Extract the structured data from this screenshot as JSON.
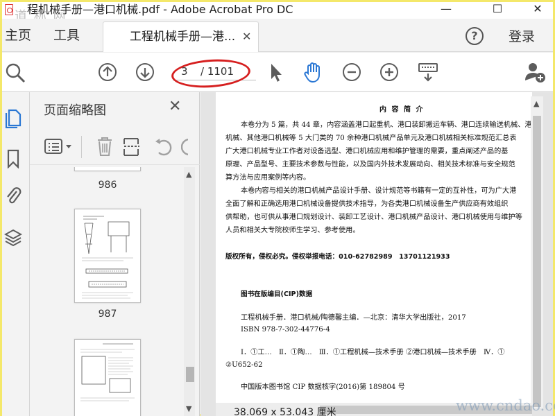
{
  "window": {
    "title": "程机械手册—港口机械.pdf - Adobe Acrobat Pro DC",
    "watermark_top": "道 称 网",
    "minimize": "—",
    "maximize": "☐",
    "close": "✕"
  },
  "tabs": {
    "home": "主页",
    "tools": "工具",
    "document": "工程机械手册—港...",
    "close": "✕",
    "login": "登录",
    "help": "?"
  },
  "toolbar": {
    "current_page": "3",
    "total_pages": "/ 1101"
  },
  "thumbnail_panel": {
    "title": "页面缩略图",
    "close": "✕",
    "pages": [
      "986",
      "987"
    ]
  },
  "document": {
    "heading": "内 容 简 介",
    "paragraphs": [
      "本卷分为 5 篇，共 44 章，内容涵盖港口起重机、港口装卸搬运车辆、港口连续输送机械、港",
      "机械、其他港口机械等 5 大门类的 70 余种港口机械产品单元及港口机械相关标准规范汇总表",
      "广大港口机械专业工作者对设备选型、港口机械应用和维护管理的需要，重点阐述产品的基",
      "原理、产品型号、主要技术参数与性能，以及国内外技术发展动向、相关技术标准与安全规范",
      "算方法与应用案例等内容。",
      "本卷内容与相关的港口机械产品设计手册、设计规范等书籍有一定的互补性，可为广大港",
      "全面了解和正确选用港口机械设备提供技术指导，为各类港口机械设备生产供应商有效组织",
      "供帮助，也可供从事港口规划设计、装卸工艺设计、港口机械产品设计、港口机械使用与维护等",
      "人员和相关大专院校师生学习、参考使用。"
    ],
    "copyright": "版权所有，侵权必究。侵权举报电话：010-62782989　13701121933",
    "cip_title": "图书在版编目(CIP)数据",
    "cip_lines": [
      "工程机械手册．港口机械/陶德馨主编．—北京：清华大学出版社，2017",
      "ISBN 978-7-302-44776-4",
      "Ⅰ．①工…　Ⅱ．①陶…　Ⅲ．①工程机械—技术手册 ②港口机械—技术手册　Ⅳ．①",
      "②U652-62",
      "中国版本图书馆 CIP 数据核字(2016)第 189804 号"
    ],
    "dimensions": "38.069 x 53.043 厘米",
    "watermark_bottom": "www.cndao.com"
  }
}
